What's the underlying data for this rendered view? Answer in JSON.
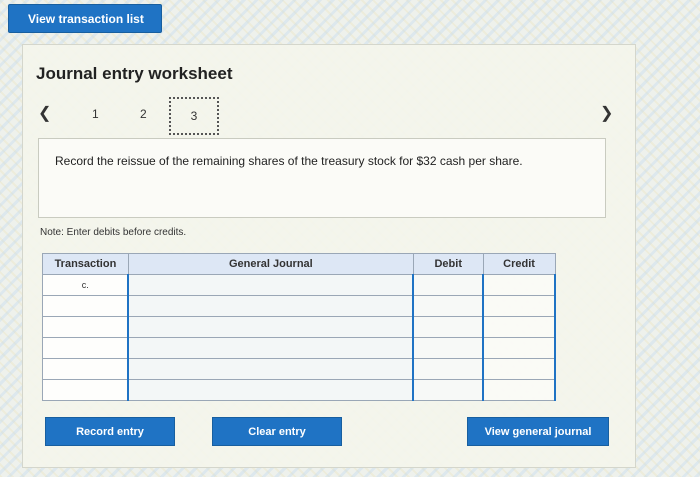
{
  "top_button": {
    "label": "View transaction list"
  },
  "worksheet": {
    "title": "Journal entry worksheet",
    "pages": [
      "1",
      "2",
      "3"
    ],
    "active_page": "3",
    "instruction": "Record the reissue of the remaining shares of the treasury stock for $32 cash per share.",
    "note": "Note: Enter debits before credits."
  },
  "table": {
    "headers": [
      "Transaction",
      "General Journal",
      "Debit",
      "Credit"
    ],
    "rows": [
      {
        "transaction": "c.",
        "account": "",
        "debit": "",
        "credit": ""
      },
      {
        "transaction": "",
        "account": "",
        "debit": "",
        "credit": ""
      },
      {
        "transaction": "",
        "account": "",
        "debit": "",
        "credit": ""
      },
      {
        "transaction": "",
        "account": "",
        "debit": "",
        "credit": ""
      },
      {
        "transaction": "",
        "account": "",
        "debit": "",
        "credit": ""
      },
      {
        "transaction": "",
        "account": "",
        "debit": "",
        "credit": ""
      }
    ]
  },
  "buttons": {
    "record_entry": "Record entry",
    "clear_entry": "Clear entry",
    "view_general_journal": "View general journal"
  },
  "colors": {
    "accent": "#1f73c4",
    "header_bg": "#dde7f5"
  }
}
